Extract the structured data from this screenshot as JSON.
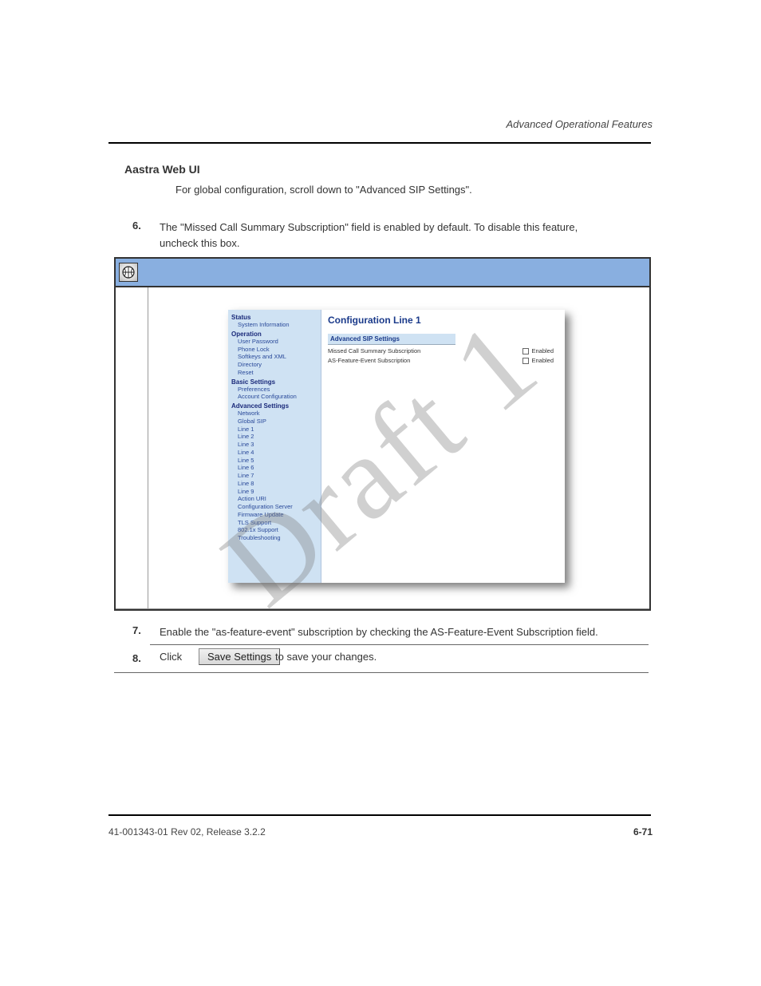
{
  "doc_header_right": "Advanced Operational Features",
  "aastra_header": "Aastra Web UI",
  "aastra_body": "For global configuration, scroll down to \"Advanced SIP Settings\".",
  "step6_num": "6.",
  "step6_text": "The \"Missed Call Summary Subscription\" field is enabled by default. To disable this feature, uncheck this box.",
  "step7_num": "7.",
  "step7_text": "Enable the \"as-feature-event\" subscription by checking the AS-Feature-Event Subscription field.",
  "step8_num": "8.",
  "step8_text": "Click                                              to save your changes.",
  "save_button_label": "Save Settings",
  "watermark": "Draft 1",
  "footer_left": "41-001343-01 Rev 02, Release 3.2.2",
  "footer_right": "6-71",
  "webui": {
    "title": "",
    "nav": {
      "status": "Status",
      "status_items": [
        "System Information"
      ],
      "operation": "Operation",
      "operation_items": [
        "User Password",
        "Phone Lock",
        "Softkeys and XML",
        "Directory",
        "Reset"
      ],
      "basic": "Basic Settings",
      "basic_items": [
        "Preferences",
        "Account Configuration"
      ],
      "advanced": "Advanced Settings",
      "advanced_items": [
        "Network",
        "Global SIP",
        "Line 1",
        "Line 2",
        "Line 3",
        "Line 4",
        "Line 5",
        "Line 6",
        "Line 7",
        "Line 8",
        "Line 9",
        "Action URI",
        "Configuration Server",
        "Firmware Update",
        "TLS Support",
        "802.1x Support",
        "Troubleshooting"
      ]
    },
    "main": {
      "heading": "Configuration Line 1",
      "section": "Advanced SIP Settings",
      "row1_label": "Missed Call Summary Subscription",
      "row1_cb": "Enabled",
      "row2_label": "AS-Feature-Event Subscription",
      "row2_cb": "Enabled"
    }
  }
}
